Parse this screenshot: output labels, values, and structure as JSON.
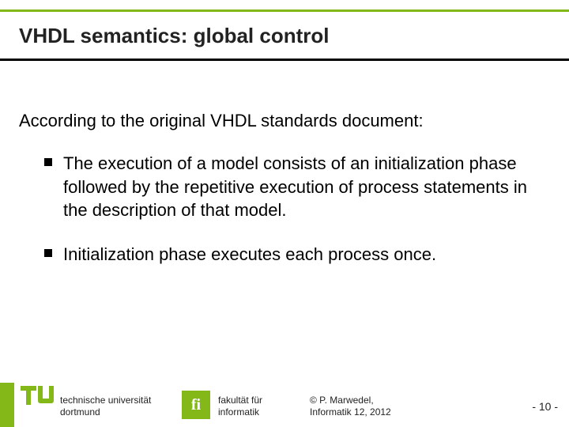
{
  "title": "VHDL semantics: global control",
  "intro": "According to the original VHDL standards document:",
  "bullets": [
    "The execution of a model consists of an initialization phase followed by the repetitive execution of process statements in the description of that model.",
    "Initialization phase executes each process once."
  ],
  "footer": {
    "tu_line1": "technische universität",
    "tu_line2": "dortmund",
    "fi_logo": "fi",
    "fi_line1": "fakultät für",
    "fi_line2": "informatik",
    "copy_line1": "© P. Marwedel,",
    "copy_line2": "Informatik 12,  2012",
    "page": "-  10 -"
  }
}
